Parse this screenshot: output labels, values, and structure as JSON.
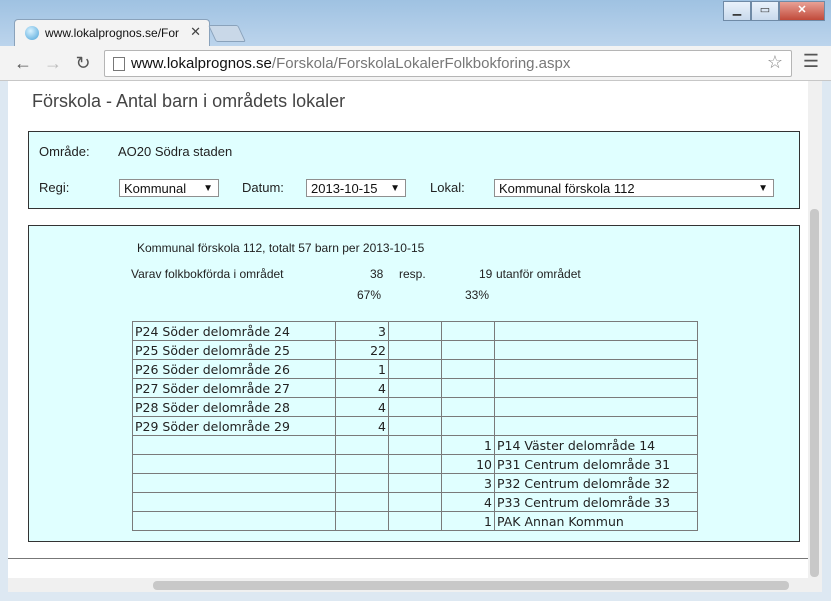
{
  "browser": {
    "tab_title": "www.lokalprognos.se/For",
    "url_host": "www.lokalprognos.se",
    "url_path": "/Forskola/ForskolaLokalerFolkbokforing.aspx"
  },
  "page": {
    "title": "Förskola - Antal barn i områdets lokaler",
    "filters": {
      "omrade_label": "Område:",
      "omrade_value": "AO20 Södra staden",
      "regi_label": "Regi:",
      "regi_value": "Kommunal",
      "datum_label": "Datum:",
      "datum_value": "2013-10-15",
      "lokal_label": "Lokal:",
      "lokal_value": "Kommunal förskola 112"
    },
    "summary": {
      "headline": "Kommunal förskola 112, totalt 57 barn per 2013-10-15",
      "folk_label": "Varav folkbokförda i området",
      "inside_count": "38",
      "resp": "resp.",
      "outside_count": "19",
      "outside_label": "utanför området",
      "inside_pct": "67%",
      "outside_pct": "33%"
    },
    "rows": [
      {
        "area": "P24 Söder delområde 24",
        "count": "3",
        "out_count": "",
        "out_area": ""
      },
      {
        "area": "P25 Söder delområde 25",
        "count": "22",
        "out_count": "",
        "out_area": ""
      },
      {
        "area": "P26 Söder delområde 26",
        "count": "1",
        "out_count": "",
        "out_area": ""
      },
      {
        "area": "P27 Söder delområde 27",
        "count": "4",
        "out_count": "",
        "out_area": ""
      },
      {
        "area": "P28 Söder delområde 28",
        "count": "4",
        "out_count": "",
        "out_area": ""
      },
      {
        "area": "P29 Söder delområde 29",
        "count": "4",
        "out_count": "",
        "out_area": ""
      },
      {
        "area": "",
        "count": "",
        "out_count": "1",
        "out_area": "P14 Väster delområde 14"
      },
      {
        "area": "",
        "count": "",
        "out_count": "10",
        "out_area": "P31 Centrum delområde 31"
      },
      {
        "area": "",
        "count": "",
        "out_count": "3",
        "out_area": "P32 Centrum delområde 32"
      },
      {
        "area": "",
        "count": "",
        "out_count": "4",
        "out_area": "P33 Centrum delområde 33"
      },
      {
        "area": "",
        "count": "",
        "out_count": "1",
        "out_area": "PAK Annan Kommun"
      }
    ]
  }
}
